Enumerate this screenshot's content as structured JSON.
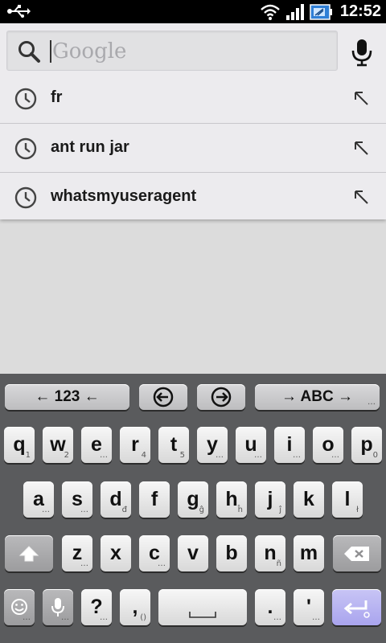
{
  "status_bar": {
    "time": "12:52",
    "icons": [
      "usb-icon",
      "wifi-icon",
      "signal-icon",
      "battery-icon"
    ]
  },
  "search": {
    "placeholder": "Google",
    "value": ""
  },
  "suggestions": [
    {
      "text": "fr"
    },
    {
      "text": "ant run jar"
    },
    {
      "text": "whatsmyuseragent"
    }
  ],
  "keyboard": {
    "top_row": {
      "numbers_label": "← 123 ←",
      "abc_label": "→ ABC →",
      "abc_sub": "…",
      "left_arrow_icon": "circle-left-arrow-icon",
      "right_arrow_icon": "circle-right-arrow-icon"
    },
    "row1": [
      {
        "main": "q",
        "sub": "1"
      },
      {
        "main": "w",
        "sub": "2"
      },
      {
        "main": "e",
        "sub": "…"
      },
      {
        "main": "r",
        "sub": "4"
      },
      {
        "main": "t",
        "sub": "5"
      },
      {
        "main": "y",
        "sub": "…"
      },
      {
        "main": "u",
        "sub": "…"
      },
      {
        "main": "i",
        "sub": "…"
      },
      {
        "main": "o",
        "sub": "…"
      },
      {
        "main": "p",
        "sub": "0"
      }
    ],
    "row2": [
      {
        "main": "a",
        "sub": "…"
      },
      {
        "main": "s",
        "sub": "…"
      },
      {
        "main": "d",
        "sub": "đ"
      },
      {
        "main": "f",
        "sub": ""
      },
      {
        "main": "g",
        "sub": "ĝ"
      },
      {
        "main": "h",
        "sub": "ĥ"
      },
      {
        "main": "j",
        "sub": "ĵ"
      },
      {
        "main": "k",
        "sub": ""
      },
      {
        "main": "l",
        "sub": "ł"
      }
    ],
    "row3": [
      {
        "main": "z",
        "sub": "…"
      },
      {
        "main": "x",
        "sub": ""
      },
      {
        "main": "c",
        "sub": "…"
      },
      {
        "main": "v",
        "sub": ""
      },
      {
        "main": "b",
        "sub": ""
      },
      {
        "main": "n",
        "sub": "ñ"
      },
      {
        "main": "m",
        "sub": ""
      }
    ],
    "row4": {
      "question": "?",
      "question_sub": "…",
      "comma": ",",
      "comma_sub": "()",
      "period": ".",
      "period_sub": "…",
      "apostrophe": "'",
      "apostrophe_sub": "…",
      "smiley_sub": "…",
      "mic_sub": "…"
    }
  },
  "colors": {
    "status_bar": "#000000",
    "search_panel": "#ecebee",
    "keyboard_bg": "#5a5b5d",
    "enter_key": "#b1acf0"
  }
}
